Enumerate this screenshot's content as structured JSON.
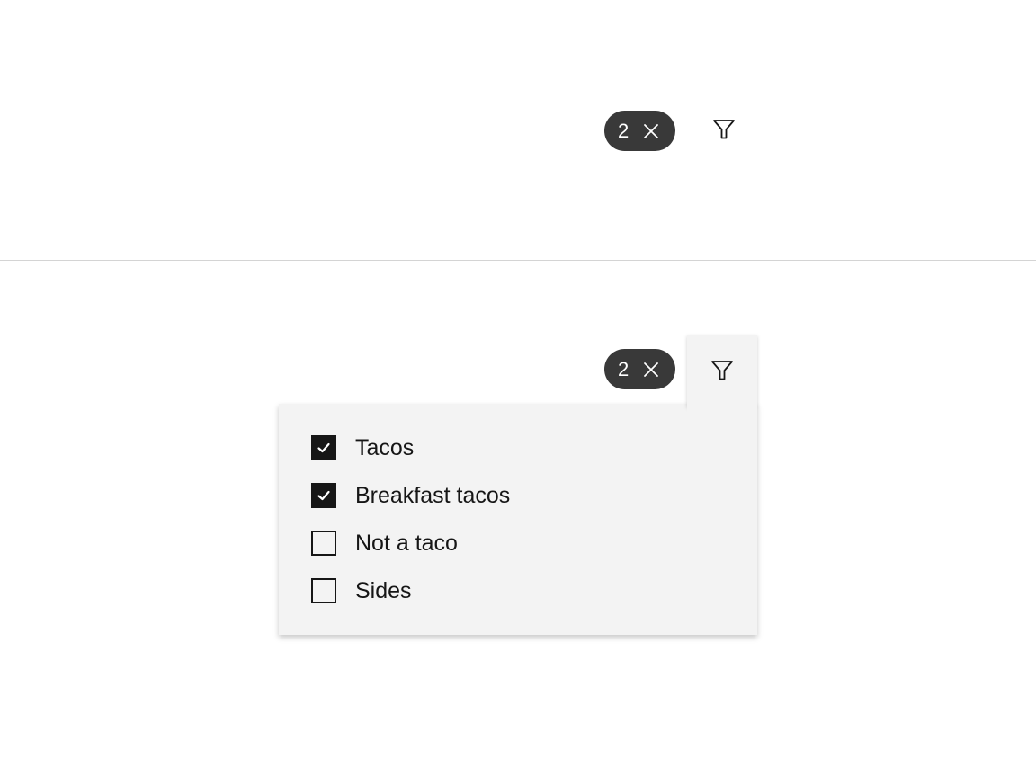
{
  "top_toolbar": {
    "selected_count": "2",
    "clear_icon": "close-icon",
    "filter_icon": "filter-icon"
  },
  "bottom_toolbar": {
    "selected_count": "2",
    "clear_icon": "close-icon",
    "filter_icon": "filter-icon",
    "menu_open": true
  },
  "filter_menu": {
    "options": [
      {
        "label": "Tacos",
        "checked": true
      },
      {
        "label": "Breakfast tacos",
        "checked": true
      },
      {
        "label": "Not a taco",
        "checked": false
      },
      {
        "label": "Sides",
        "checked": false
      }
    ]
  },
  "colors": {
    "tag_background": "#393939",
    "menu_background": "#f3f3f3",
    "text": "#161616",
    "divider": "#d4d4d4"
  }
}
